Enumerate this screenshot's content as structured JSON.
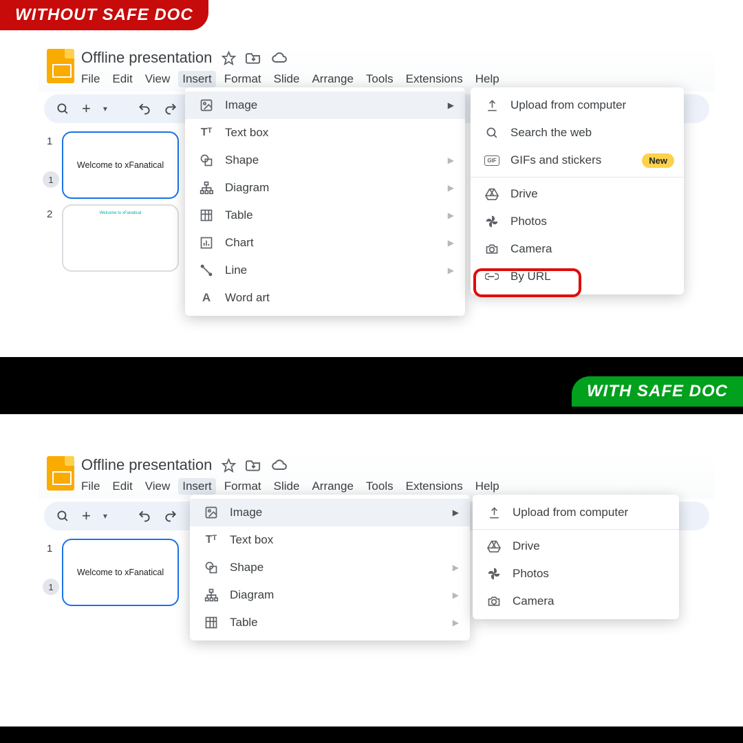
{
  "banners": {
    "without": "WITHOUT SAFE DOC",
    "with": "WITH SAFE DOC"
  },
  "doc": {
    "title": "Offline presentation",
    "menus": [
      "File",
      "Edit",
      "View",
      "Insert",
      "Format",
      "Slide",
      "Arrange",
      "Tools",
      "Extensions",
      "Help"
    ],
    "active_menu": "Insert"
  },
  "slide_text": "Welcome to xFanatical",
  "thumbs": {
    "n1": "1",
    "n2": "2",
    "badge": "1"
  },
  "insert_menu": {
    "image": "Image",
    "textbox": "Text box",
    "shape": "Shape",
    "diagram": "Diagram",
    "table": "Table",
    "chart": "Chart",
    "line": "Line",
    "wordart": "Word art"
  },
  "image_submenu_full": {
    "upload": "Upload from computer",
    "search": "Search the web",
    "gifs": "GIFs and stickers",
    "gifs_badge": "New",
    "drive": "Drive",
    "photos": "Photos",
    "camera": "Camera",
    "byurl": "By URL"
  },
  "image_submenu_safe": {
    "upload": "Upload from computer",
    "drive": "Drive",
    "photos": "Photos",
    "camera": "Camera"
  },
  "toolbar": {
    "plus": "+",
    "caret": "▾"
  }
}
